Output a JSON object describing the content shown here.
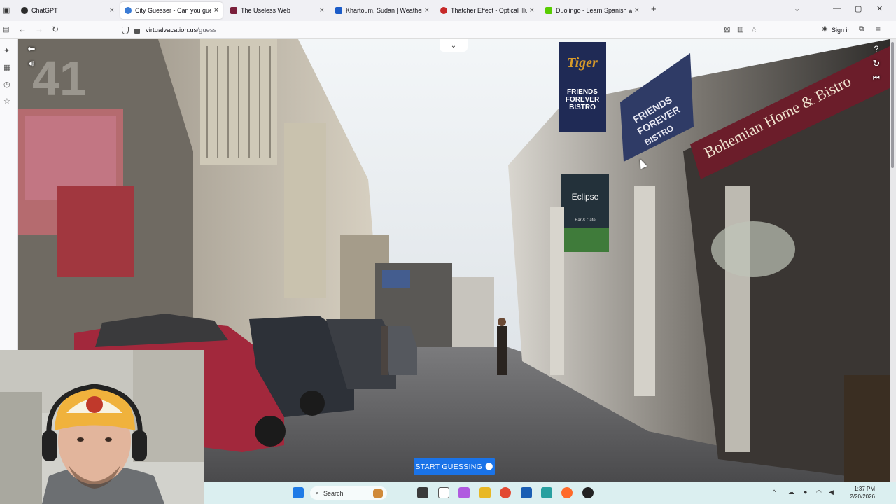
{
  "tabs": [
    {
      "title": "ChatGPT",
      "fav_color": "#2b2b2b",
      "active": false
    },
    {
      "title": "City Guesser - Can you guess w",
      "fav_color": "#3a7bd5",
      "active": true
    },
    {
      "title": "The Useless Web",
      "fav_color": "#7a1f3a",
      "active": false
    },
    {
      "title": "Khartoum, Sudan | Weather Sat",
      "fav_color": "#1c5cc8",
      "active": false
    },
    {
      "title": "Thatcher Effect - Optical Illusio",
      "fav_color": "#c62828",
      "active": false
    },
    {
      "title": "Duolingo - Learn Spanish with I",
      "fav_color": "#58cc02",
      "active": false
    }
  ],
  "tab_close": "×",
  "new_tab": "+",
  "window_controls": {
    "list": "⌄",
    "minimize": "—",
    "maximize": "▢",
    "close": "✕"
  },
  "nav": {
    "back": "←",
    "forward": "→",
    "reload": "↻",
    "sign_in": "Sign in"
  },
  "url": {
    "host": "virtualvacation.us",
    "path": "/guess"
  },
  "game": {
    "start_label": "START GUESSING",
    "start_icon": "map-pin-icon",
    "collapse_icon": "chevron-down-icon",
    "controls": [
      "back-arrow-icon",
      "speaker-icon",
      "help-icon",
      "refresh-icon",
      "skip-back-icon"
    ]
  },
  "signs": {
    "tiger": "Tiger",
    "tiger_lines": [
      "FRIENDS",
      "FOREVER",
      "BISTRO"
    ],
    "friends": [
      "FRIENDS",
      "FOREVER",
      "BISTRO"
    ],
    "bohemian": "Bohemian Home & Bistro",
    "eclipse": "Eclipse",
    "eclipse_sub": "Bar & Cafe",
    "number": "41"
  },
  "taskbar": {
    "search_placeholder": "Search",
    "time": "1:37 PM",
    "date": "2/20/2026"
  }
}
